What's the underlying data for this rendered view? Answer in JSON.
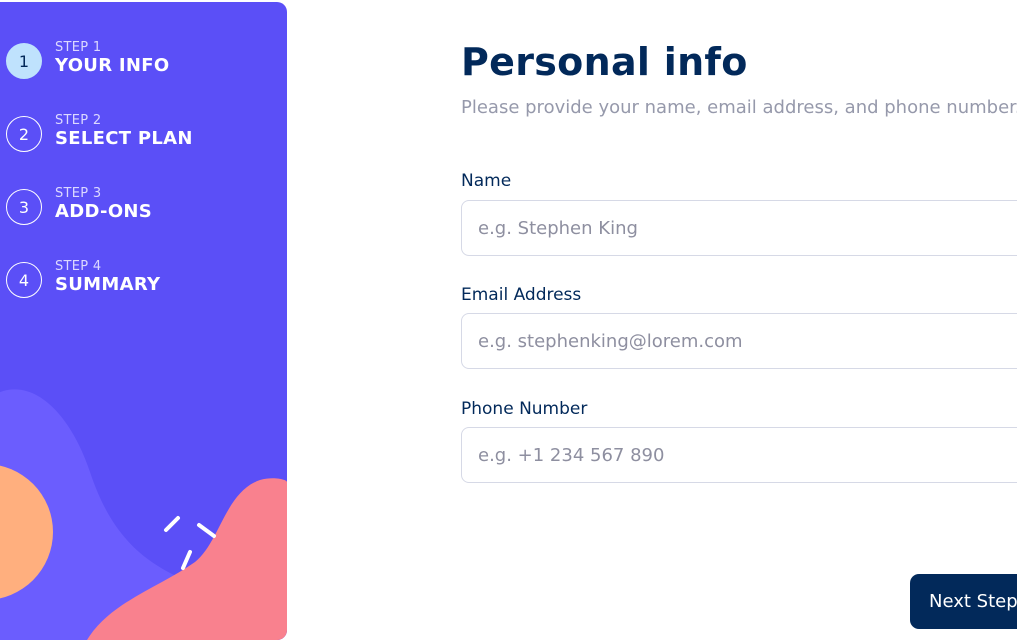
{
  "sidebar": {
    "steps": [
      {
        "number": "1",
        "label": "STEP 1",
        "title": "YOUR INFO",
        "active": true
      },
      {
        "number": "2",
        "label": "STEP 2",
        "title": "SELECT PLAN",
        "active": false
      },
      {
        "number": "3",
        "label": "STEP 3",
        "title": "ADD-ONS",
        "active": false
      },
      {
        "number": "4",
        "label": "STEP 4",
        "title": "SUMMARY",
        "active": false
      }
    ]
  },
  "main": {
    "title": "Personal info",
    "subtitle": "Please provide your name, email address, and phone number.",
    "fields": {
      "name": {
        "label": "Name",
        "placeholder": "e.g. Stephen King",
        "value": ""
      },
      "email": {
        "label": "Email Address",
        "placeholder": "e.g. stephenking@lorem.com",
        "value": ""
      },
      "phone": {
        "label": "Phone Number",
        "placeholder": "e.g. +1 234 567 890",
        "value": ""
      }
    },
    "next_button": "Next Step"
  },
  "colors": {
    "sidebar_bg": "#5b4ff7",
    "active_step_bg": "#bfe2fd",
    "primary_text": "#02295a",
    "muted_text": "#9699ab",
    "input_border": "#d6d9e6"
  }
}
